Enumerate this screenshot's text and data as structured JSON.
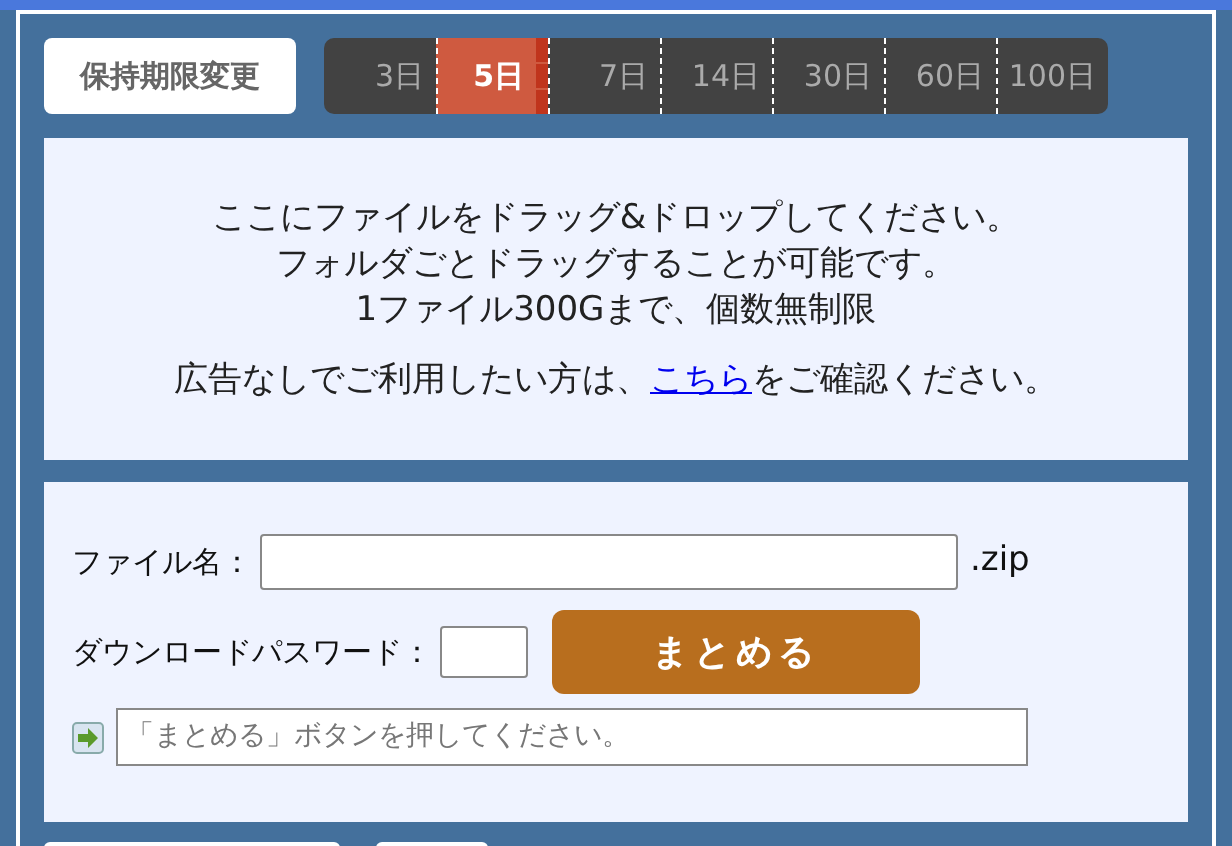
{
  "retention_button": "保持期限変更",
  "periods": [
    {
      "label": "3日",
      "selected": false
    },
    {
      "label": "5日",
      "selected": true
    },
    {
      "label": "7日",
      "selected": false
    },
    {
      "label": "14日",
      "selected": false
    },
    {
      "label": "30日",
      "selected": false
    },
    {
      "label": "60日",
      "selected": false
    },
    {
      "label": "100日",
      "selected": false
    }
  ],
  "drop_zone": {
    "lines": [
      "ここにファイルをドラッグ&ドロップしてください。",
      "フォルダごとドラッグすることが可能です。",
      "1ファイル300Gまで、個数無制限"
    ],
    "ad_note": {
      "before": "広告なしでご利用したい方は、",
      "link": "こちら",
      "after": "をご確認ください。"
    }
  },
  "form": {
    "filename_label": "ファイル名：",
    "extension": ".zip",
    "password_label": "ダウンロードパスワード：",
    "submit": "まとめる",
    "status": "「まとめる」ボタンを押してください。"
  }
}
